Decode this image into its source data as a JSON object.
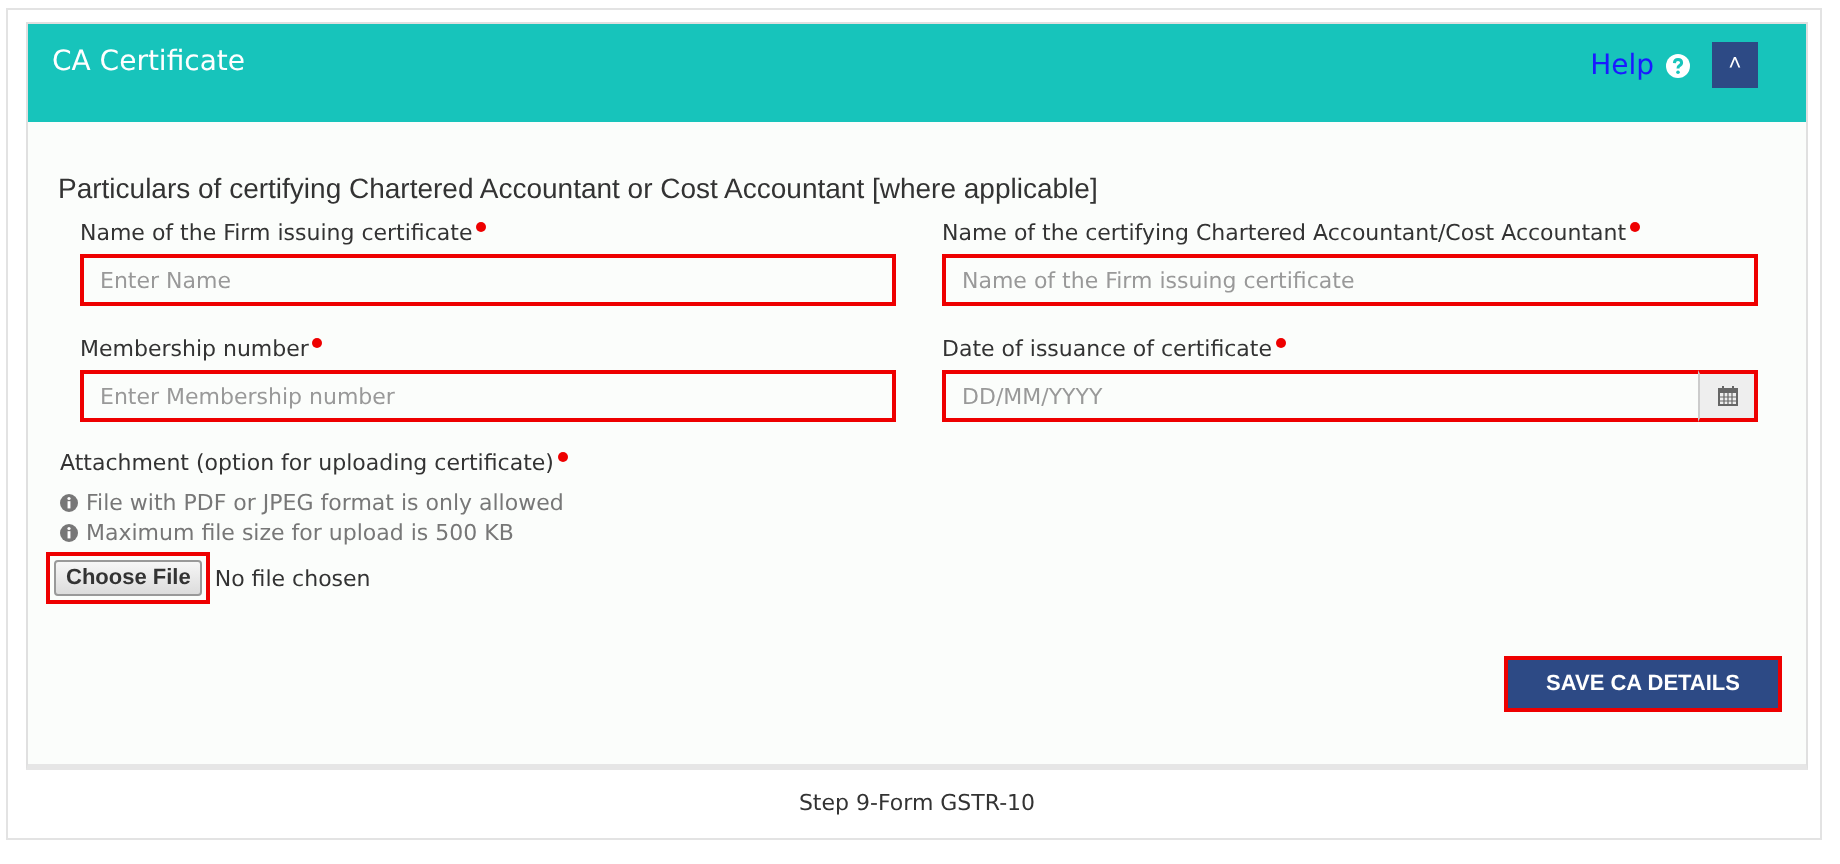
{
  "panel": {
    "title": "CA Certificate",
    "help": "Help",
    "collapse_icon": "˄"
  },
  "section_heading": "Particulars of certifying Chartered Accountant or Cost Accountant [where applicable]",
  "fields": [
    {
      "kind": "text",
      "label": "Name of the Firm issuing certificate",
      "required": true,
      "placeholder": "Enter Name",
      "highlighted": true
    },
    {
      "kind": "text",
      "label": "Name of the certifying Chartered Accountant/Cost Accountant",
      "required": true,
      "placeholder": "Name of the Firm issuing certificate",
      "highlighted": true
    },
    {
      "kind": "text",
      "label": "Membership number",
      "required": true,
      "placeholder": "Enter Membership number",
      "highlighted": true
    },
    {
      "kind": "date",
      "label": "Date of issuance of certificate",
      "required": true,
      "placeholder": "DD/MM/YYYY",
      "highlighted": true
    }
  ],
  "attachment": {
    "label": "Attachment (option for uploading certificate)",
    "required": true,
    "notes": [
      "File with PDF or JPEG format is only allowed",
      "Maximum file size for upload is 500 KB"
    ],
    "button": "Choose File",
    "button_highlighted": true,
    "status": "No file chosen"
  },
  "save_button": {
    "label": "SAVE CA DETAILS",
    "highlighted": true
  },
  "caption": "Step 9-Form GSTR-10"
}
